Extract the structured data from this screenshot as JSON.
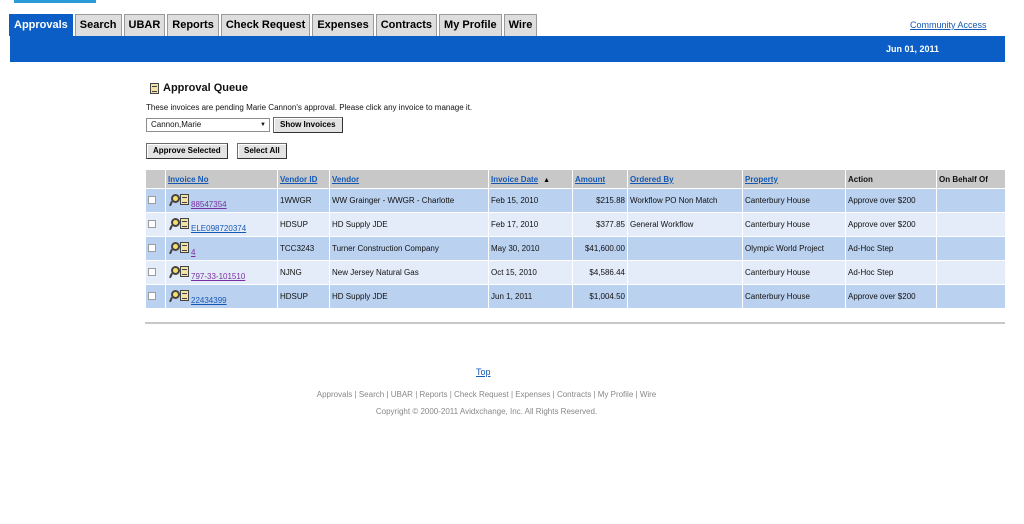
{
  "tabs": [
    {
      "label": "Approvals",
      "active": true
    },
    {
      "label": "Search",
      "active": false
    },
    {
      "label": "UBAR",
      "active": false
    },
    {
      "label": "Reports",
      "active": false
    },
    {
      "label": "Check Request",
      "active": false
    },
    {
      "label": "Expenses",
      "active": false
    },
    {
      "label": "Contracts",
      "active": false
    },
    {
      "label": "My Profile",
      "active": false
    },
    {
      "label": "Wire",
      "active": false
    }
  ],
  "header": {
    "community_link": "Community Access",
    "date": "Jun 01, 2011",
    "bar_color": "#0a5ec5"
  },
  "queue": {
    "title": "Approval Queue",
    "description": "These invoices are pending Marie Cannon's approval. Please click any invoice to manage it.",
    "approver_select": "Cannon,Marie",
    "show_invoices_label": "Show Invoices",
    "approve_selected_label": "Approve Selected",
    "select_all_label": "Select All"
  },
  "table": {
    "columns": {
      "invoice_no": "Invoice No",
      "vendor_id": "Vendor ID",
      "vendor": "Vendor",
      "invoice_date": "Invoice Date",
      "amount": "Amount",
      "ordered_by": "Ordered By",
      "property": "Property",
      "action": "Action",
      "on_behalf_of": "On Behalf Of"
    },
    "sort_indicator": "▲",
    "rows": [
      {
        "invoice_no": "88547354",
        "vendor_id": "1WWGR",
        "vendor": "WW Grainger - WWGR - Charlotte",
        "invoice_date": "Feb 15, 2010",
        "amount": "$215.88",
        "ordered_by": "Workflow PO Non Match",
        "property": "Canterbury House",
        "action": "Approve over $200",
        "on_behalf_of": "",
        "visited": true
      },
      {
        "invoice_no": "ELE098720374",
        "vendor_id": "HDSUP",
        "vendor": "HD Supply JDE",
        "invoice_date": "Feb 17, 2010",
        "amount": "$377.85",
        "ordered_by": "General Workflow",
        "property": "Canterbury House",
        "action": "Approve over $200",
        "on_behalf_of": "",
        "visited": false
      },
      {
        "invoice_no": "4",
        "vendor_id": "TCC3243",
        "vendor": "Turner Construction Company",
        "invoice_date": "May 30, 2010",
        "amount": "$41,600.00",
        "ordered_by": "",
        "property": "Olympic World Project",
        "action": "Ad-Hoc Step",
        "on_behalf_of": "",
        "visited": true
      },
      {
        "invoice_no": "797-33-101510",
        "vendor_id": "NJNG",
        "vendor": "New Jersey Natural Gas",
        "invoice_date": "Oct 15, 2010",
        "amount": "$4,586.44",
        "ordered_by": "",
        "property": "Canterbury House",
        "action": "Ad-Hoc Step",
        "on_behalf_of": "",
        "visited": true
      },
      {
        "invoice_no": "22434399",
        "vendor_id": "HDSUP",
        "vendor": "HD Supply JDE",
        "invoice_date": "Jun 1, 2011",
        "amount": "$1,004.50",
        "ordered_by": "",
        "property": "Canterbury House",
        "action": "Approve over $200",
        "on_behalf_of": "",
        "visited": false
      }
    ]
  },
  "footer": {
    "top_link": "Top",
    "nav": [
      "Approvals",
      "Search",
      "UBAR",
      "Reports",
      "Check Request",
      "Expenses",
      "Contracts",
      "My Profile",
      "Wire"
    ],
    "separator": " | ",
    "copyright": "Copyright © 2000-2011 Avidxchange, Inc.  All Rights Reserved."
  }
}
